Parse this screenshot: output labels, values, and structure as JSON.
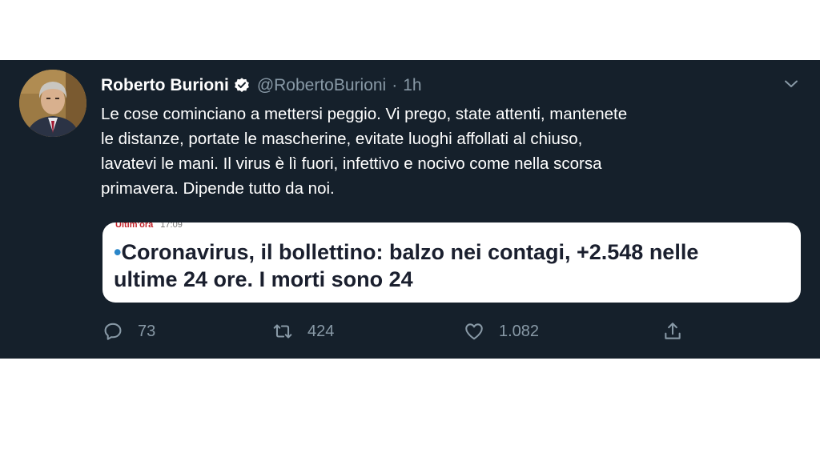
{
  "tweet": {
    "author_name": "Roberto Burioni",
    "handle": "@RobertoBurioni",
    "separator": "·",
    "time": "1h",
    "text_lines": [
      "Le cose cominciano a mettersi peggio. Vi prego, state attenti, mantenete",
      "le distanze, portate le mascherine, evitate luoghi affollati al chiuso,",
      "lavatevi le mani. Il virus è lì fuori, infettivo e nocivo come nella scorsa",
      "primavera. Dipende tutto da noi."
    ]
  },
  "card": {
    "tag": "Ultim'ora",
    "time": "17:09",
    "bullet": "•",
    "headline_line1": "Coronavirus, il bollettino: balzo nei contagi, +2.548 nelle",
    "headline_line2": "ultime 24 ore. I morti sono 24"
  },
  "actions": {
    "replies": "73",
    "retweets": "424",
    "likes": "1.082"
  },
  "icons": {
    "verified": "verified-badge-icon",
    "more": "chevron-down-icon",
    "reply": "reply-icon",
    "retweet": "retweet-icon",
    "like": "heart-icon",
    "share": "share-icon"
  },
  "colors": {
    "background": "#15202b",
    "secondary_text": "#8899a6",
    "card_background": "#ffffff",
    "card_tag": "#c2222a",
    "card_bullet": "#2a86c9"
  }
}
